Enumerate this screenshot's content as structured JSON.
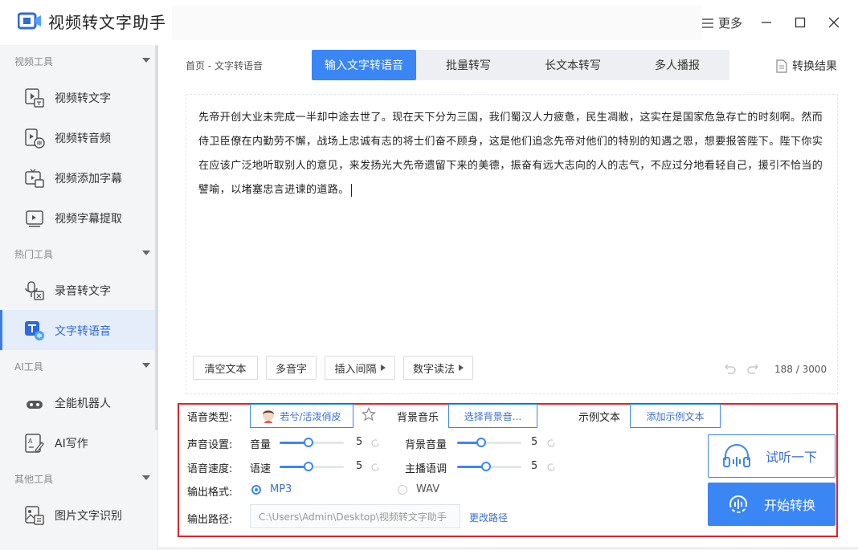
{
  "app": {
    "title": "视频转文字助手",
    "more_label": "更多"
  },
  "colors": {
    "accent": "#3b86f5",
    "highlight_border": "#e0242b",
    "sidebar_bg": "#f4f5f7"
  },
  "sidebar": {
    "groups": [
      {
        "label": "视频工具",
        "items": [
          {
            "label": "视频转文字",
            "icon": "video-to-text-icon"
          },
          {
            "label": "视频转音频",
            "icon": "video-to-audio-icon"
          },
          {
            "label": "视频添加字幕",
            "icon": "add-subtitle-icon"
          },
          {
            "label": "视频字幕提取",
            "icon": "subtitle-extract-icon"
          }
        ]
      },
      {
        "label": "热门工具",
        "items": [
          {
            "label": "录音转文字",
            "icon": "record-to-text-icon"
          },
          {
            "label": "文字转语音",
            "icon": "text-to-speech-icon",
            "active": true
          }
        ]
      },
      {
        "label": "AI工具",
        "items": [
          {
            "label": "全能机器人",
            "icon": "robot-icon"
          },
          {
            "label": "AI写作",
            "icon": "ai-writing-icon"
          }
        ]
      },
      {
        "label": "其他工具",
        "items": [
          {
            "label": "图片文字识别",
            "icon": "image-ocr-icon"
          }
        ]
      }
    ]
  },
  "breadcrumb": "首页 - 文字转语音",
  "tabs": [
    {
      "label": "输入文字转语音",
      "active": true
    },
    {
      "label": "批量转写"
    },
    {
      "label": "长文本转写"
    },
    {
      "label": "多人播报"
    }
  ],
  "result_label": "转换结果",
  "editor": {
    "text": "先帝开创大业未完成一半却中途去世了。现在天下分为三国，我们蜀汉人力疲惫，民生凋敝，这实在是国家危急存亡的时刻啊。然而侍卫臣僚在内勤劳不懈，战场上忠诚有志的将士们奋不顾身，这是他们追念先帝对他们的特别的知遇之恩，想要报答陛下。陛下你实在应该广泛地听取别人的意见，来发扬光大先帝遗留下来的美德，振奋有远大志向的人的志气，不应过分地看轻自己，援引不恰当的譬喻，以堵塞忠言进谏的道路。",
    "buttons": {
      "clear": "清空文本",
      "polyphone": "多音字",
      "insert_pause": "插入间隔",
      "number_reading": "数字读法"
    },
    "count": "188",
    "max": "3000",
    "count_sep": "/"
  },
  "settings": {
    "voice_type_label": "语音类型:",
    "voice_value": "若兮/活泼俏皮",
    "bg_music_label": "背景音乐",
    "bg_music_btn": "选择背景音...",
    "sample_text_label": "示例文本",
    "sample_text_btn": "添加示例文本",
    "sound_label": "声音设置:",
    "volume_label": "音量",
    "volume_value": "5",
    "bg_volume_label": "背景音量",
    "bg_volume_value": "5",
    "speed_label": "语音速度:",
    "rate_label": "语速",
    "rate_value": "5",
    "pitch_label": "主播语调",
    "pitch_value": "5",
    "format_label": "输出格式:",
    "format_mp3": "MP3",
    "format_wav": "WAV",
    "format_selected": "MP3",
    "path_label": "输出路径:",
    "path_value": "C:\\Users\\Admin\\Desktop\\视频转文字助手",
    "change_path": "更改路径",
    "listen_btn": "试听一下",
    "start_btn": "开始转换"
  }
}
